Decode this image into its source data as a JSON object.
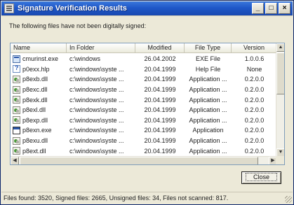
{
  "window": {
    "title": "Signature Verification Results",
    "minimize_glyph": "_",
    "maximize_glyph": "□",
    "close_glyph": "×"
  },
  "intro_text": "The following files have not been digitally signed:",
  "table": {
    "columns": [
      "Name",
      "In Folder",
      "Modified",
      "File Type",
      "Version"
    ],
    "rows": [
      {
        "icon": "exe-icon",
        "name": "cmurinst.exe",
        "folder": "c:\\windows",
        "modified": "26.04.2002",
        "type": "EXE File",
        "version": "1.0.0.6"
      },
      {
        "icon": "help-icon",
        "name": "p0exx.hlp",
        "folder": "c:\\windows\\syste ...",
        "modified": "20.04.1999",
        "type": "Help File",
        "version": "None"
      },
      {
        "icon": "dll-icon",
        "name": "p8exb.dll",
        "folder": "c:\\windows\\syste ...",
        "modified": "20.04.1999",
        "type": "Application ...",
        "version": "0.2.0.0"
      },
      {
        "icon": "dll-icon",
        "name": "p8exc.dll",
        "folder": "c:\\windows\\syste ...",
        "modified": "20.04.1999",
        "type": "Application ...",
        "version": "0.2.0.0"
      },
      {
        "icon": "dll-icon",
        "name": "p8exk.dll",
        "folder": "c:\\windows\\syste ...",
        "modified": "20.04.1999",
        "type": "Application ...",
        "version": "0.2.0.0"
      },
      {
        "icon": "dll-icon",
        "name": "p8exl.dll",
        "folder": "c:\\windows\\syste ...",
        "modified": "20.04.1999",
        "type": "Application ...",
        "version": "0.2.0.0"
      },
      {
        "icon": "dll-icon",
        "name": "p8exp.dll",
        "folder": "c:\\windows\\syste ...",
        "modified": "20.04.1999",
        "type": "Application ...",
        "version": "0.2.0.0"
      },
      {
        "icon": "app-icon",
        "name": "p8exn.exe",
        "folder": "c:\\windows\\syste ...",
        "modified": "20.04.1999",
        "type": "Application",
        "version": "0.2.0.0"
      },
      {
        "icon": "dll-icon",
        "name": "p8exu.dll",
        "folder": "c:\\windows\\syste ...",
        "modified": "20.04.1999",
        "type": "Application ...",
        "version": "0.2.0.0"
      },
      {
        "icon": "dll-icon",
        "name": "p8ext.dll",
        "folder": "c:\\windows\\syste ...",
        "modified": "20.04.1999",
        "type": "Application ...",
        "version": "0.2.0.0"
      }
    ]
  },
  "close_button_label": "Close",
  "status_text": "Files found: 3520,  Signed files: 2665,  Unsigned files: 34,  Files not scanned: 817.",
  "colors": {
    "titlebar": "#1f58c8",
    "dialog": "#ece9d8"
  }
}
